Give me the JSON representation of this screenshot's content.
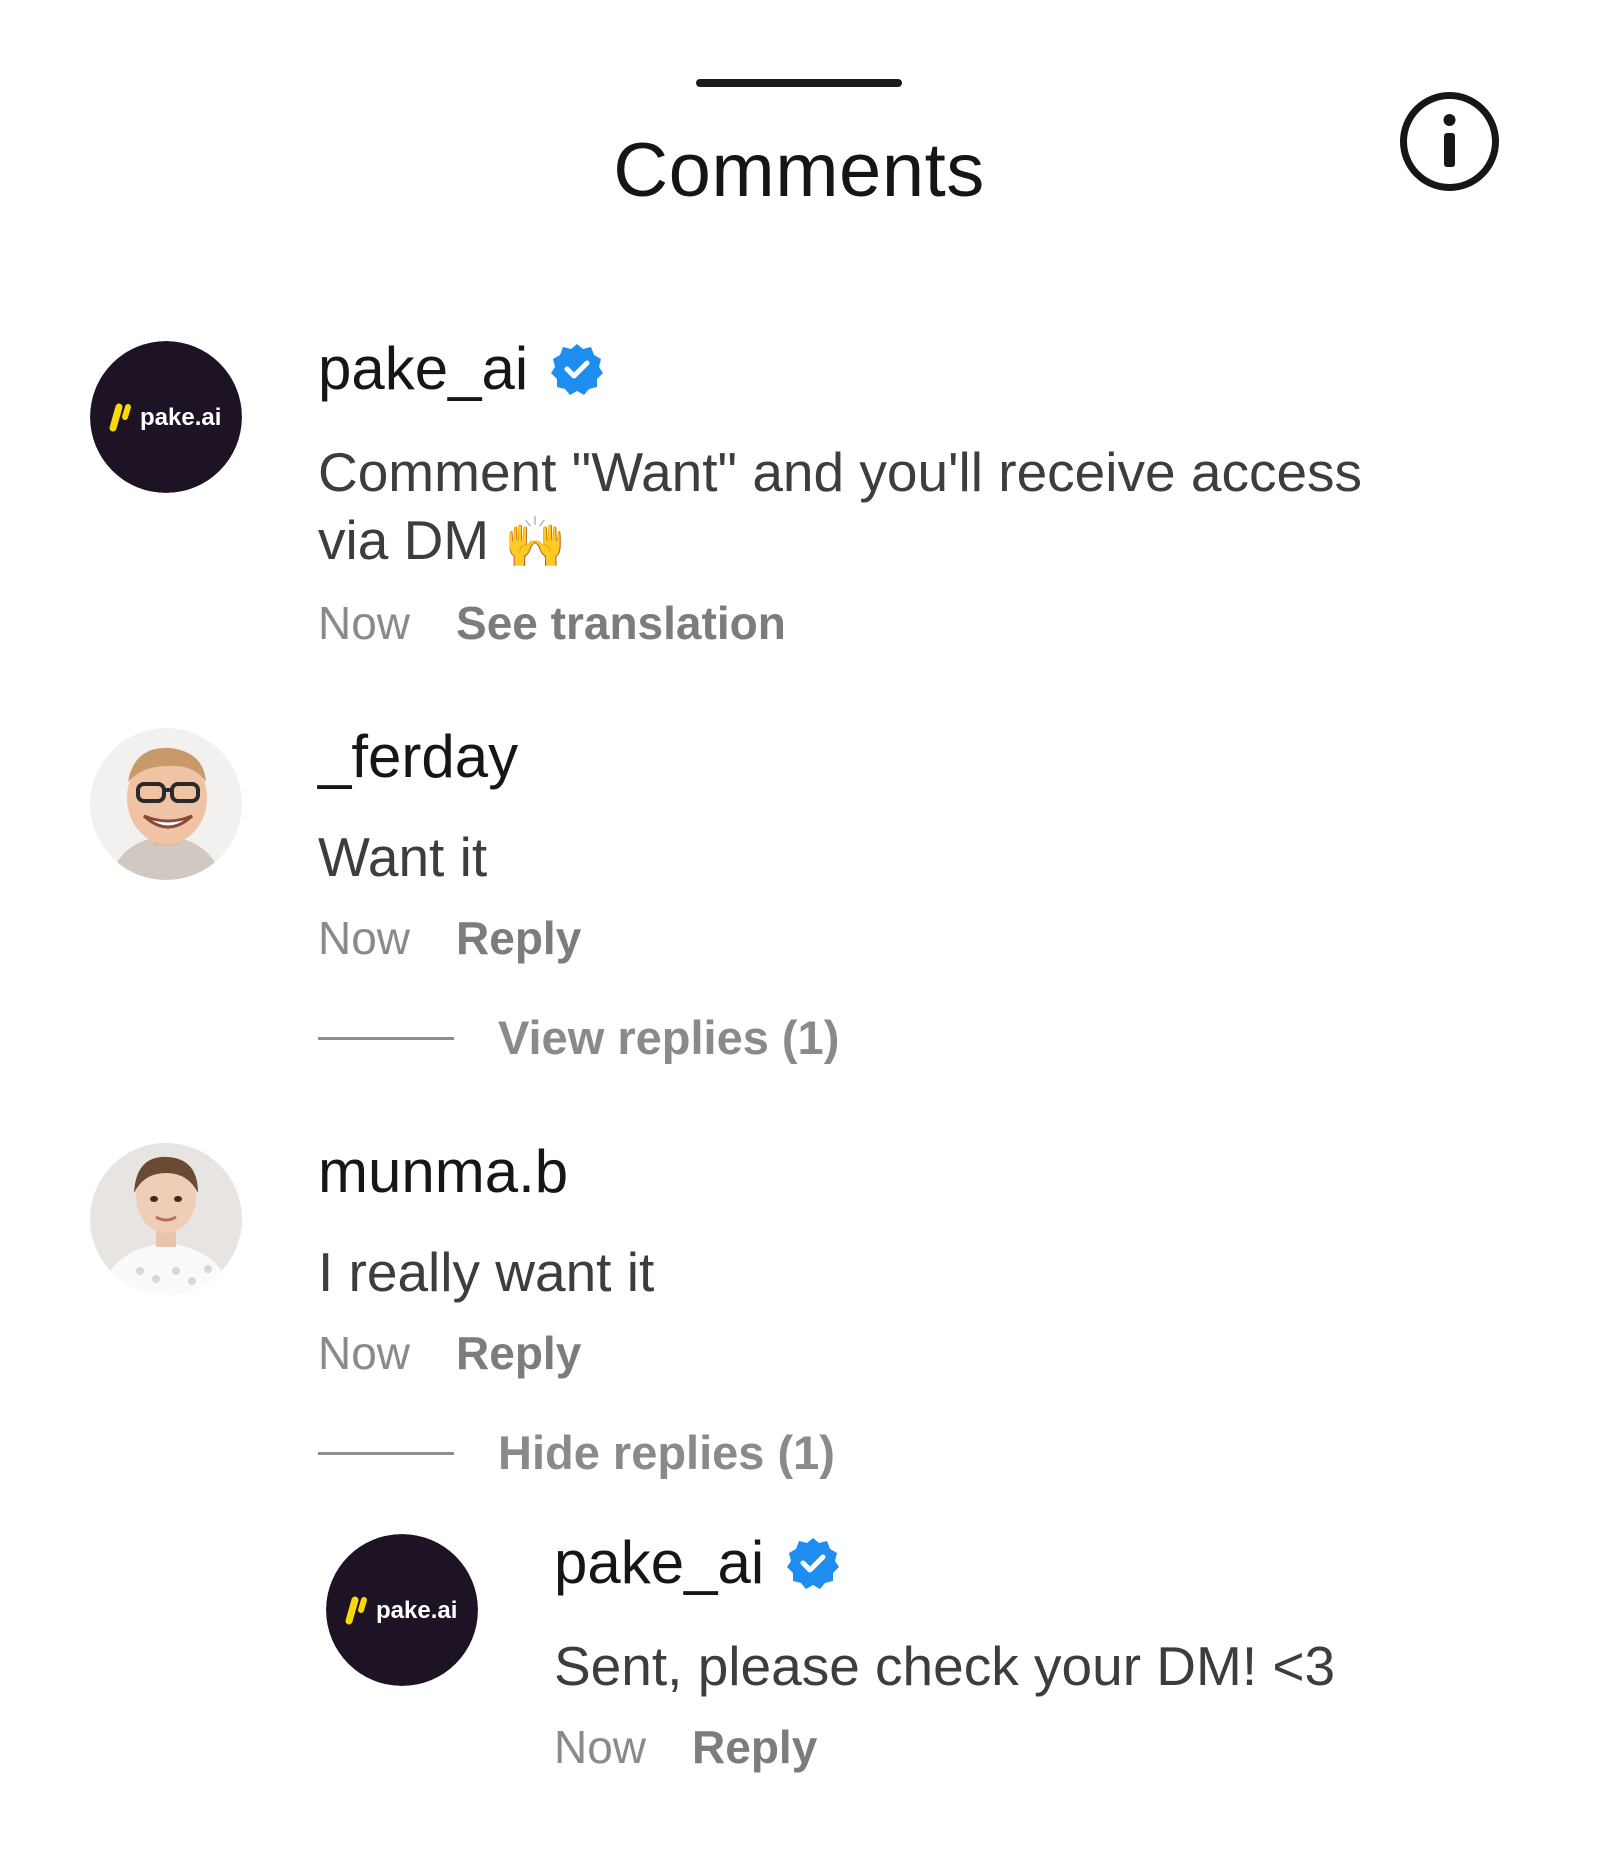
{
  "header": {
    "title": "Comments",
    "info_icon": "info-circle-icon"
  },
  "colors": {
    "verified_badge": "#1d8ef0",
    "brand_avatar_bg": "#1e1324",
    "brand_accent": "#f5d90a",
    "text_primary": "#161616",
    "text_secondary": "#3d3d3d",
    "text_muted": "#8a8a8a"
  },
  "comments": [
    {
      "username": "pake_ai",
      "verified": true,
      "avatar": {
        "type": "logo",
        "label": "pake.ai"
      },
      "text_line1": "Comment \"Want\" and you'll receive access",
      "text_line2": "via DM",
      "emoji": "🙌",
      "time": "Now",
      "action": "See translation"
    },
    {
      "username": "_ferday",
      "verified": false,
      "avatar": {
        "type": "photo",
        "icon": "man-with-glasses-avatar"
      },
      "text": "Want it",
      "time": "Now",
      "action": "Reply",
      "replies_toggle": "View replies (1)"
    },
    {
      "username": "munma.b",
      "verified": false,
      "avatar": {
        "type": "photo",
        "icon": "woman-avatar"
      },
      "text": "I really want it",
      "time": "Now",
      "action": "Reply",
      "replies_toggle": "Hide replies (1)",
      "replies": [
        {
          "username": "pake_ai",
          "verified": true,
          "avatar": {
            "type": "logo",
            "label": "pake.ai"
          },
          "text": "Sent, please check your DM! <3",
          "time": "Now",
          "action": "Reply"
        }
      ]
    }
  ]
}
